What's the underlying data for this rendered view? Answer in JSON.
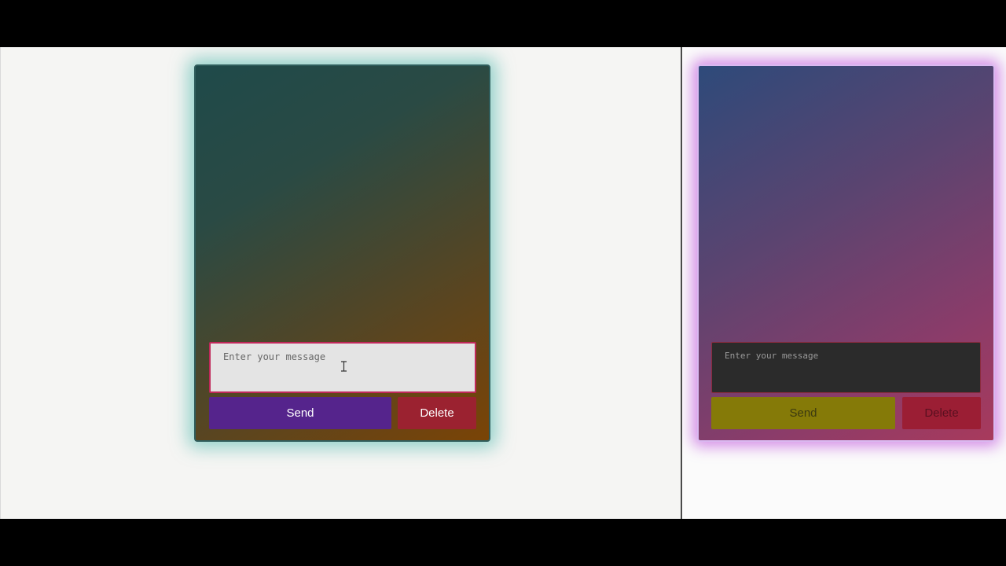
{
  "left_panel": {
    "card": {
      "message_input": {
        "placeholder": "Enter your message",
        "value": ""
      },
      "send_label": "Send",
      "delete_label": "Delete"
    }
  },
  "right_panel": {
    "card": {
      "message_input": {
        "placeholder": "Enter your message",
        "value": ""
      },
      "send_label": "Send",
      "delete_label": "Delete"
    }
  },
  "icons": {
    "text_cursor": "i-beam-cursor-icon"
  },
  "colors": {
    "left_card_glow": "#46b4aa",
    "left_send": "#55248c",
    "left_delete": "#9b2230",
    "left_input_border": "#c0285a",
    "right_card_glow": "#be50dc",
    "right_send": "#857a08",
    "right_delete": "#9b1e34",
    "right_input_bg": "#2b2b2b"
  }
}
